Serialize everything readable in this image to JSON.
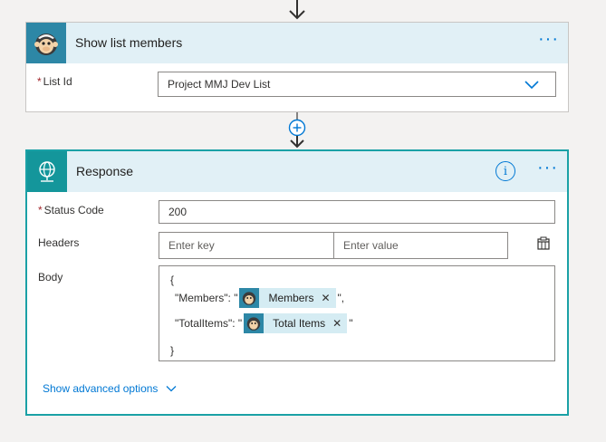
{
  "mailchimp_card": {
    "title": "Show list members",
    "more_label": "···",
    "list_id": {
      "label": "List Id",
      "required_mark": "*",
      "value": "Project MMJ Dev List"
    }
  },
  "response_card": {
    "title": "Response",
    "info_label": "i",
    "more_label": "···",
    "status_code": {
      "label": "Status Code",
      "required_mark": "*",
      "value": "200"
    },
    "headers": {
      "label": "Headers",
      "key_placeholder": "Enter key",
      "value_placeholder": "Enter value"
    },
    "body": {
      "label": "Body",
      "open_brace": "{",
      "close_brace": "}",
      "members_key": "\"Members\": \"",
      "members_token": "Members",
      "members_suffix": "\",",
      "total_key": "\"TotalItems\": \"",
      "total_token": "Total Items",
      "total_suffix": "\""
    },
    "advanced_label": "Show advanced options"
  },
  "colors": {
    "accent": "#0078d4",
    "response_border": "#1aa1a6",
    "header_bg": "#e1f0f6",
    "mailchimp_icon_bg": "#2d87a6",
    "response_icon_bg": "#14969b"
  },
  "icons": {
    "mailchimp": "mailchimp-monkey-icon",
    "response": "globe-request-icon",
    "add_step": "plus-circle-icon",
    "dropdown": "chevron-down-icon",
    "header_mode": "switch-text-mode-icon"
  }
}
